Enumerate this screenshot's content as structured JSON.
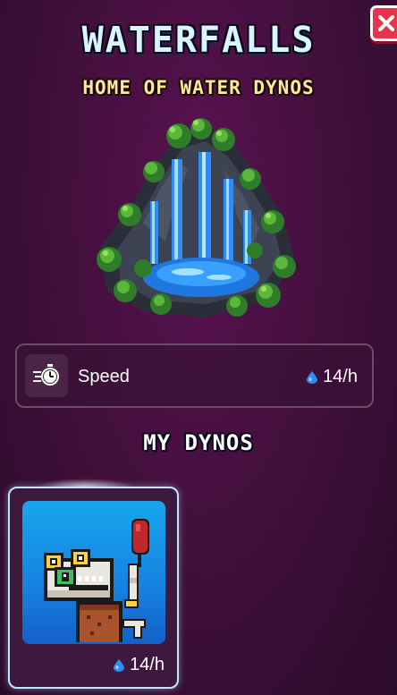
{
  "header": {
    "title": "WATERFALLS",
    "subtitle": "HOME OF WATER DYNOS"
  },
  "close_button": {
    "icon": "close-icon"
  },
  "location_art": {
    "icon": "waterfall-island-illustration"
  },
  "stat": {
    "icon": "speed-stopwatch-icon",
    "label": "Speed",
    "rate_icon": "water-drop-icon",
    "rate": "14/h"
  },
  "my_dynos": {
    "title": "MY DYNOS",
    "cards": [
      {
        "portrait": "water-dyno-character",
        "rate_icon": "water-drop-icon",
        "rate": "14/h"
      }
    ]
  },
  "colors": {
    "background": "#43103d",
    "close_button": "#e8334a",
    "title": "#d9f3ff",
    "subtitle": "#ffe89a",
    "water_drop": "#2f8df5",
    "card_border": "#bfe6ff",
    "portrait_background": "#1782e0"
  }
}
